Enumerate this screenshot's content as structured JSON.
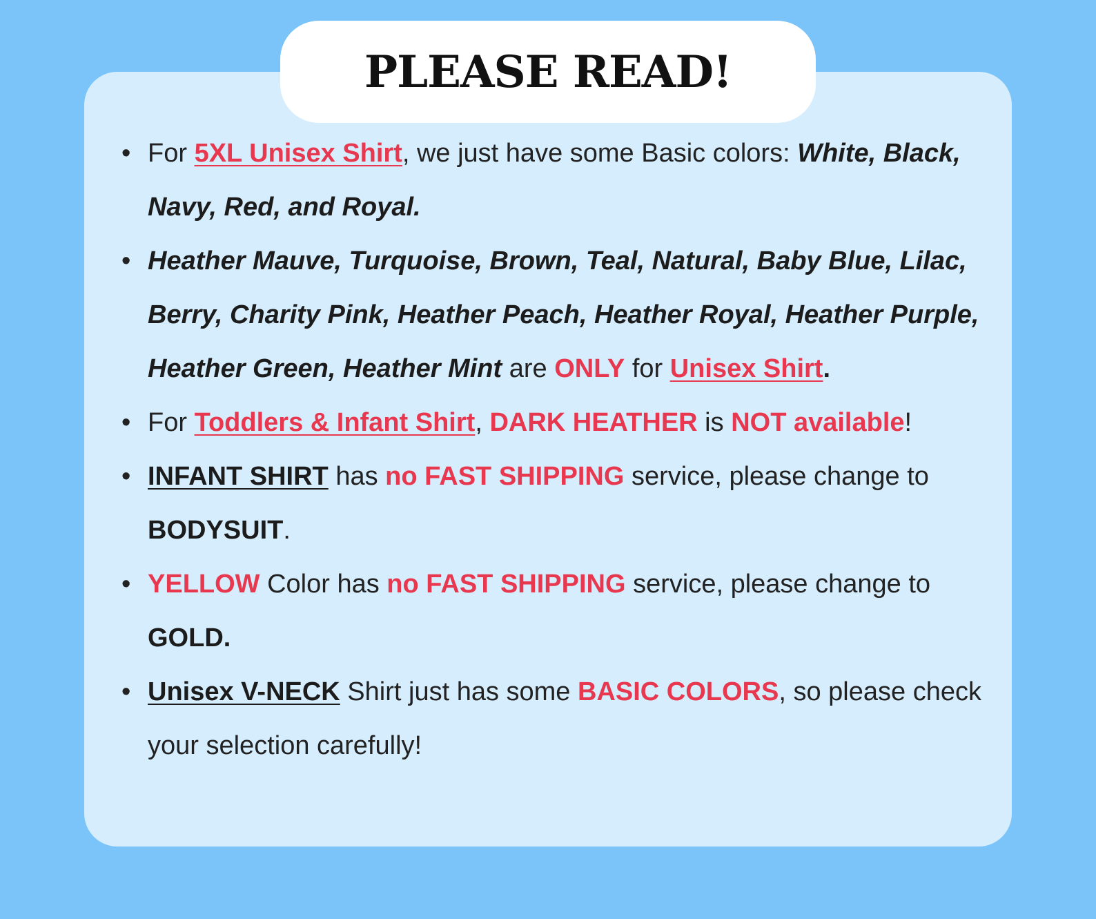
{
  "title": "PLEASE READ!",
  "items": [
    {
      "segments": [
        {
          "text": "For ",
          "style": "plain"
        },
        {
          "text": "5XL Unisex Shirt",
          "style": "red-bold-underline"
        },
        {
          "text": ", we just have some Basic colors: ",
          "style": "plain"
        },
        {
          "text": "White, Black, Navy, Red, and Royal.",
          "style": "bold-italic"
        }
      ]
    },
    {
      "segments": [
        {
          "text": "Heather Mauve, Turquoise, Brown, Teal, Natural, Baby Blue, Lilac, Berry, Charity Pink, Heather Peach, Heather Royal, Heather Purple, Heather Green, Heather Mint",
          "style": "bold-italic"
        },
        {
          "text": " are ",
          "style": "plain"
        },
        {
          "text": "ONLY",
          "style": "red-bold"
        },
        {
          "text": " for ",
          "style": "plain"
        },
        {
          "text": "Unisex Shirt",
          "style": "red-bold-underline"
        },
        {
          "text": ".",
          "style": "bold"
        }
      ]
    },
    {
      "segments": [
        {
          "text": "For ",
          "style": "plain"
        },
        {
          "text": "Toddlers & Infant Shirt",
          "style": "red-bold-underline"
        },
        {
          "text": ", ",
          "style": "plain"
        },
        {
          "text": "DARK HEATHER",
          "style": "red-bold"
        },
        {
          "text": " is ",
          "style": "plain"
        },
        {
          "text": "NOT available",
          "style": "red-bold"
        },
        {
          "text": "!",
          "style": "plain"
        }
      ]
    },
    {
      "segments": [
        {
          "text": "INFANT SHIRT",
          "style": "bold-underline"
        },
        {
          "text": " has ",
          "style": "plain"
        },
        {
          "text": "no FAST SHIPPING",
          "style": "red-bold"
        },
        {
          "text": " service, please change to ",
          "style": "plain"
        },
        {
          "text": "BODYSUIT",
          "style": "bold"
        },
        {
          "text": ".",
          "style": "plain"
        }
      ]
    },
    {
      "segments": [
        {
          "text": "YELLOW",
          "style": "red-bold"
        },
        {
          "text": " Color has ",
          "style": "plain"
        },
        {
          "text": "no FAST SHIPPING",
          "style": "red-bold"
        },
        {
          "text": " service, please change to ",
          "style": "plain"
        },
        {
          "text": "GOLD.",
          "style": "bold"
        }
      ]
    },
    {
      "segments": [
        {
          "text": "Unisex V-NECK",
          "style": "bold-underline"
        },
        {
          "text": " Shirt just has some ",
          "style": "plain"
        },
        {
          "text": "BASIC COLORS",
          "style": "red-bold"
        },
        {
          "text": ", so please check your selection carefully!",
          "style": "plain"
        }
      ]
    }
  ],
  "colors": {
    "background": "#7ac4f9",
    "card": "#d6edfd",
    "accent_red": "#e8384f",
    "text": "#222222"
  },
  "bullet_icon": "bullet-dot-icon"
}
